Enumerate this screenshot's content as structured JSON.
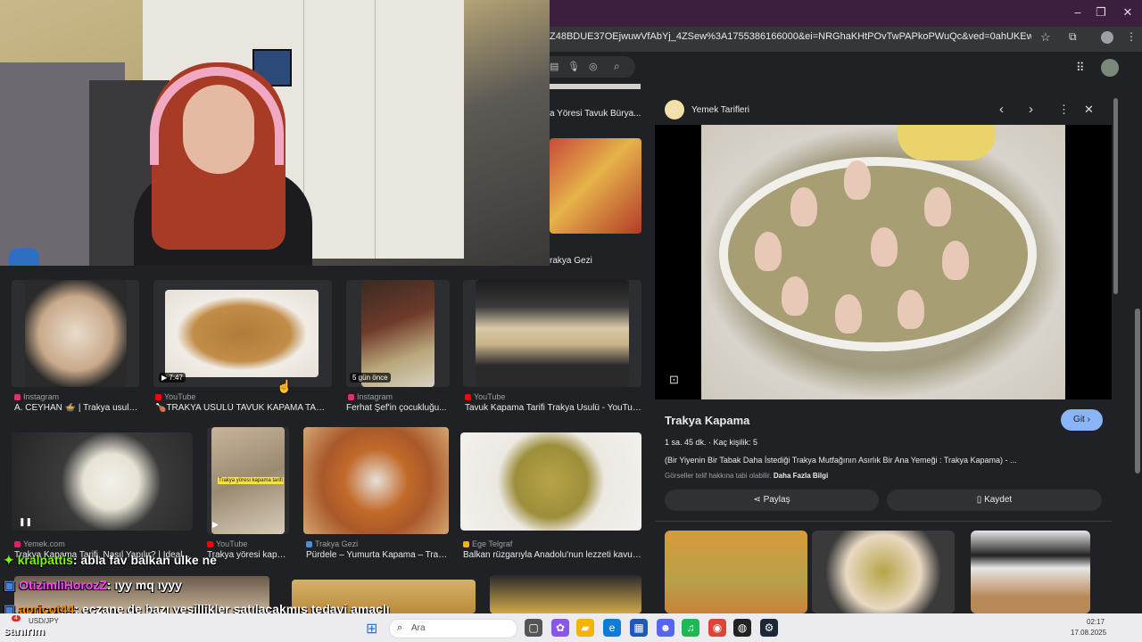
{
  "browser": {
    "url": "Z48BDUE37OEjwuwVfAbYj_4ZSew%3A1755386166000&ei=NRGhaKHtPOvTwPAPkoPWuQc&ved=0ahUKEwjh2_iGu5CPAxXrKRAIH...",
    "win_minimize": "–",
    "win_restore": "❐",
    "win_close": "✕"
  },
  "results": {
    "partial_top1": "a Yöresi Tavuk Bürya...",
    "partial_top2": "rakya Gezi",
    "row1": [
      {
        "source": "Instagram",
        "title": "A. CEYHAN 🍲 | Trakya usulü...",
        "badge": "",
        "src_color": "#e1306c"
      },
      {
        "source": "YouTube",
        "title": "🍗TRAKYA USULÜ TAVUK KAPAMA TARİ...",
        "badge": "▶ 7:47",
        "src_color": "#ff0000"
      },
      {
        "source": "Instagram",
        "title": "Ferhat Şef'in çocukluğu...",
        "badge": "5 gün önce",
        "src_color": "#e1306c"
      },
      {
        "source": "YouTube",
        "title": "Tavuk Kapama Tarifi Trakya Usulü - YouTube",
        "badge": "",
        "src_color": "#ff0000"
      }
    ],
    "row2": [
      {
        "source": "Yemek.com",
        "title": "Trakya Kapama Tarifi, Nasıl Yapılır? | Ideal...",
        "badge": "",
        "src_color": "#e91e63"
      },
      {
        "source": "YouTube",
        "title": "Trakya yöresi kapa...",
        "badge": "",
        "src_color": "#ff0000",
        "overlay": "Trakya yöresi kapama tarifi"
      },
      {
        "source": "Trakya Gezi",
        "title": "Pürdele – Yumurta Kapama – Trak...",
        "badge": "",
        "src_color": "#4a90d9"
      },
      {
        "source": "Ege Telgraf",
        "title": "Balkan rüzgarıyla Anadolu'nun lezzeti kavuş...",
        "badge": "",
        "src_color": "#f4b400"
      }
    ]
  },
  "panel": {
    "source_name": "Yemek Tarifleri",
    "title": "Trakya Kapama",
    "visit_label": "Git",
    "visit_arrow": "›",
    "duration": "1 sa. 45 dk.",
    "servings": "Kaç kişilik: 5",
    "description": "(Bir Yiyenin Bir Tabak Daha İstediği Trakya Mutfağının Asırlık Bir Ana Yemeği : Trakya Kapama) - ...",
    "copyright": "Görseller telif hakkına tabi olabilir.",
    "learn_more": "Daha Fazla Bilgi",
    "share_label": "Paylaş",
    "save_label": "Kaydet"
  },
  "chat": [
    {
      "user": "kralpattis",
      "message": ": abla fav balkan ulke ne",
      "color": "#7cfc00"
    },
    {
      "user": "OtizimliHorozZ",
      "message": ": ıyy mq ıyyy",
      "color": "#ff4aff"
    },
    {
      "user": "apricot44",
      "message": ": eczane de bazı yeşillikler satılacakmış tedavi amaçlı",
      "color": "#ff8c00"
    }
  ],
  "caption_word": "sanırım",
  "taskbar": {
    "search_placeholder": "Ara",
    "ticker": "USD/JPY",
    "notification_count": "4",
    "time": "02:17",
    "date": "17.08.2025"
  }
}
